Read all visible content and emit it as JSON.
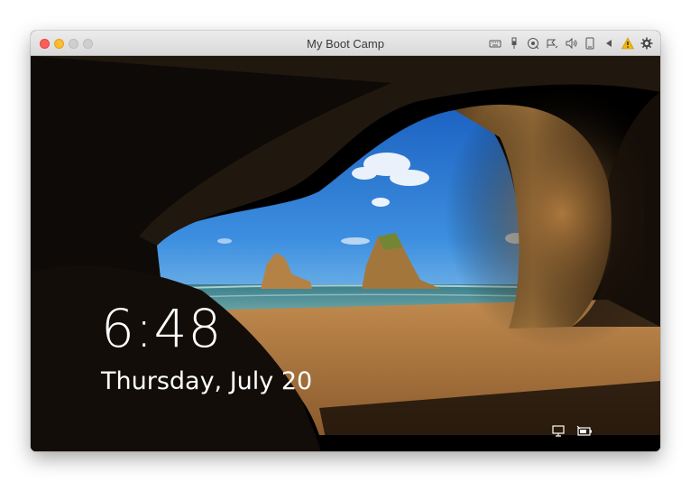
{
  "window": {
    "title": "My Boot Camp",
    "toolbar_icons": [
      "keyboard-icon",
      "usb-icon",
      "camera-icon",
      "network-icon",
      "sound-icon",
      "device-icon",
      "back-arrow-icon",
      "warning-icon",
      "gear-icon"
    ]
  },
  "lockscreen": {
    "time": "6:48",
    "date": "Thursday, July 20",
    "status_icons": [
      "network-status-icon",
      "battery-status-icon"
    ]
  },
  "colors": {
    "warning": "#f2b705",
    "sky": "#2f7fd6",
    "sand": "#b37a3c"
  }
}
